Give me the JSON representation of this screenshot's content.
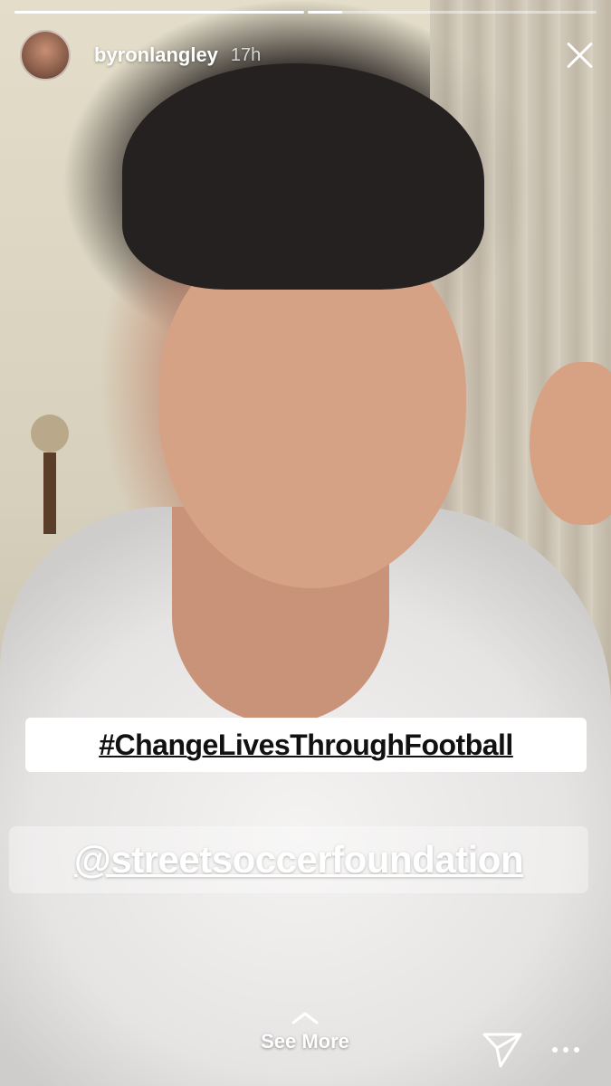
{
  "story": {
    "username": "byronlangley",
    "time_ago": "17h",
    "progress": [
      1.0,
      0.12
    ],
    "avatar_icon": "profile-avatar"
  },
  "stickers": {
    "hashtag": "#ChangeLivesThroughFootball",
    "mention": "@streetsoccerfoundation"
  },
  "footer": {
    "see_more_label": "See More",
    "send_icon": "send-icon",
    "more_icon": "more-options-icon"
  }
}
